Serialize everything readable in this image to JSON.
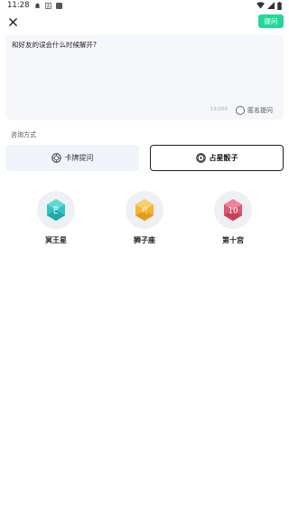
{
  "status_bar": {
    "time": "11:28"
  },
  "header": {
    "ask_button": "提问"
  },
  "question": {
    "text": "和好友的误会什么时候解开?",
    "char_count": "13/200",
    "anonymous_label": "匿名提问"
  },
  "consult": {
    "section_label": "咨询方式",
    "tabs": [
      {
        "label": "卡牌提问",
        "selected": false
      },
      {
        "label": "占星骰子",
        "selected": true
      }
    ]
  },
  "dice": [
    {
      "label": "冥王星",
      "glyph": "♇",
      "color": "#2ec5c4",
      "icon": "pluto-die-icon"
    },
    {
      "label": "狮子座",
      "glyph": "♌",
      "color": "#f5b731",
      "icon": "leo-die-icon"
    },
    {
      "label": "第十宫",
      "glyph": "10",
      "color": "#e0566e",
      "icon": "tenth-house-die-icon"
    }
  ],
  "colors": {
    "accent": "#22d89a",
    "panel_bg": "#f6f7fb"
  }
}
